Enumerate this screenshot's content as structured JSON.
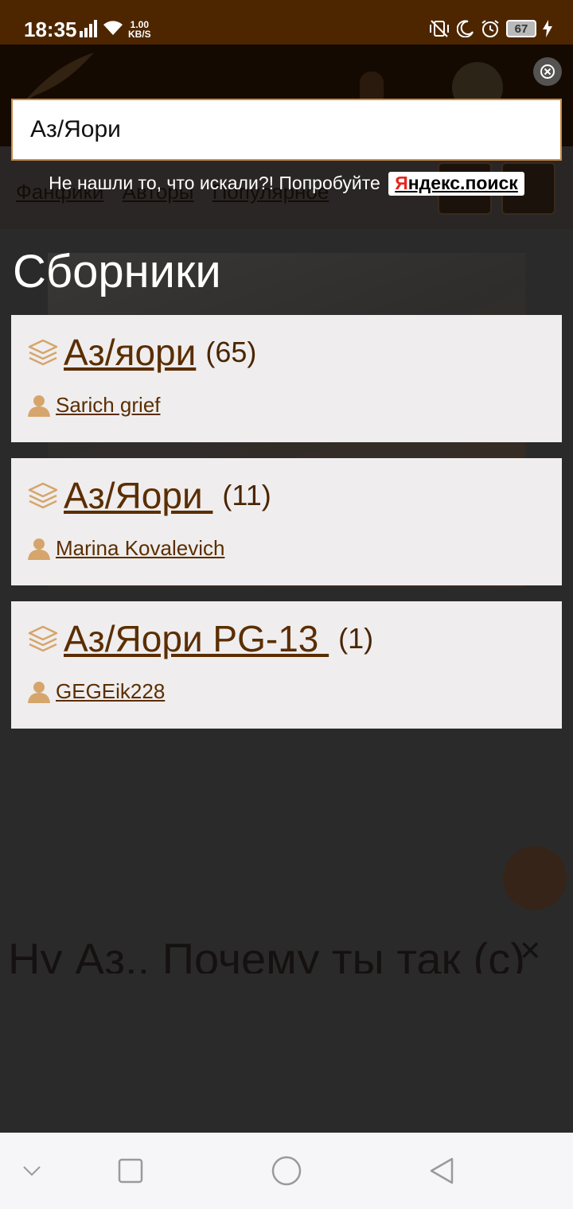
{
  "status_bar": {
    "time": "18:35",
    "net_speed_value": "1.00",
    "net_speed_unit": "KB/S",
    "battery": "67"
  },
  "background": {
    "nav_links": [
      "Фанфики",
      "Авторы",
      "Популярное"
    ],
    "heading_text": "Ну Аз.. Почему ты так (с)"
  },
  "search": {
    "value": "Аз/Яори",
    "hint_text": "Не нашли то, что искали?! Попробуйте",
    "yandex_first": "Я",
    "yandex_rest": "ндекс.поиск"
  },
  "section_title": "Сборники",
  "collections": [
    {
      "title": "Аз/яори",
      "count": "(65)",
      "author": "Sarich grief"
    },
    {
      "title": "Аз/Яори ",
      "count": "(11)",
      "author": "Marina Kovalevich"
    },
    {
      "title": "Аз/Яори PG-13 ",
      "count": "(1)",
      "author": "GEGEik228"
    }
  ],
  "colors": {
    "status_bar": "#4d2600",
    "accent_brown": "#5b2e00",
    "icon_tan": "#d6a56c",
    "card_bg": "#efedee",
    "search_border": "#c98c42"
  },
  "icons": {
    "collection": "layers-icon",
    "author": "user-icon",
    "close": "close-circle-icon"
  }
}
